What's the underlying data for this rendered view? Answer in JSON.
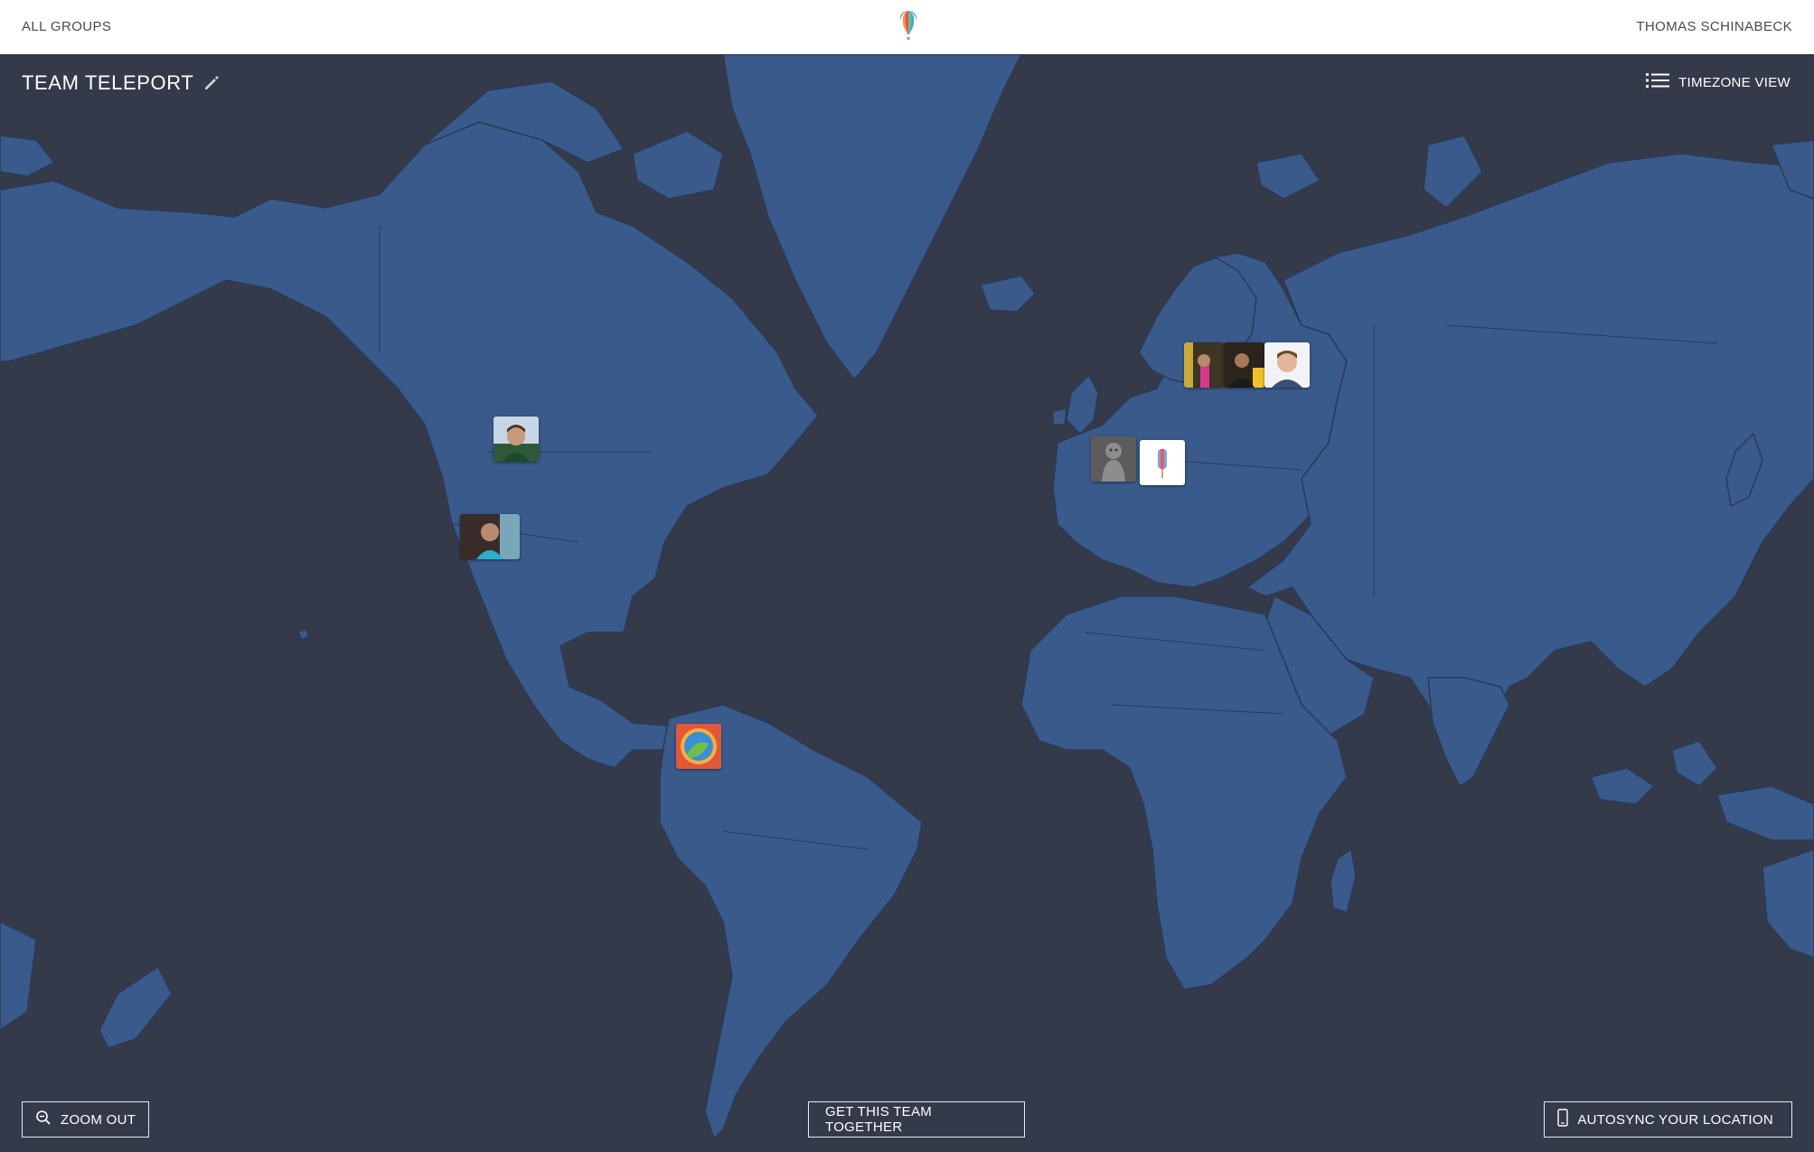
{
  "header": {
    "left_link": "ALL GROUPS",
    "right_link": "THOMAS SCHINABECK"
  },
  "group": {
    "name": "TEAM TELEPORT"
  },
  "view_toggle": {
    "label": "TIMEZONE VIEW"
  },
  "actions": {
    "zoom_out": "ZOOM OUT",
    "gather": "GET THIS TEAM TOGETHER",
    "autosync": "AUTOSYNC YOUR LOCATION"
  },
  "colors": {
    "ocean": "#353a4b",
    "land": "#3a5a8c",
    "border": "#2b3a55",
    "topbar": "#ffffff"
  },
  "icons": {
    "logo": "balloon-logo-icon",
    "edit": "pencil-icon",
    "view": "list-icon",
    "zoom": "magnifier-icon",
    "sync": "phone-icon"
  }
}
